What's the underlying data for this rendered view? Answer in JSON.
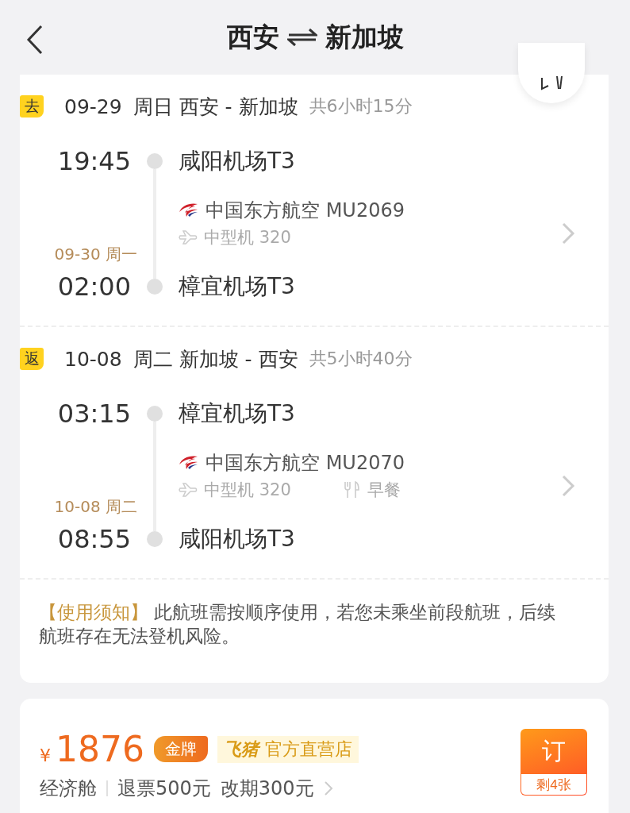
{
  "header": {
    "from": "西安",
    "to": "新加坡"
  },
  "legs": [
    {
      "tag": "去",
      "date": "09-29",
      "weekday": "周日",
      "route": "西安 - 新加坡",
      "duration": "共6小时15分",
      "departure": {
        "time": "19:45",
        "airport": "咸阳机场T3"
      },
      "airline": "中国东方航空 MU2069",
      "aircraft": "中型机 320",
      "arrival_date": "09-30 周一",
      "arrival": {
        "time": "02:00",
        "airport": "樟宜机场T3"
      }
    },
    {
      "tag": "返",
      "date": "10-08",
      "weekday": "周二",
      "route": "新加坡 - 西安",
      "duration": "共5小时40分",
      "departure": {
        "time": "03:15",
        "airport": "樟宜机场T3"
      },
      "airline": "中国东方航空 MU2070",
      "aircraft": "中型机 320",
      "meal": "早餐",
      "arrival_date": "10-08 周二",
      "arrival": {
        "time": "08:55",
        "airport": "咸阳机场T3"
      }
    }
  ],
  "notice": {
    "label": "【使用须知】",
    "text": "此航班需按顺序使用，若您未乘坐前段航班，后续航班存在无法登机风险。"
  },
  "offer": {
    "currency": "¥",
    "price": "1876",
    "badge": "金牌",
    "store_brand": "飞猪",
    "store": "官方直营店",
    "cabin": "经济舱",
    "refund": "退票500元",
    "change": "改期300元",
    "book": "订",
    "remaining": "剩4张"
  }
}
